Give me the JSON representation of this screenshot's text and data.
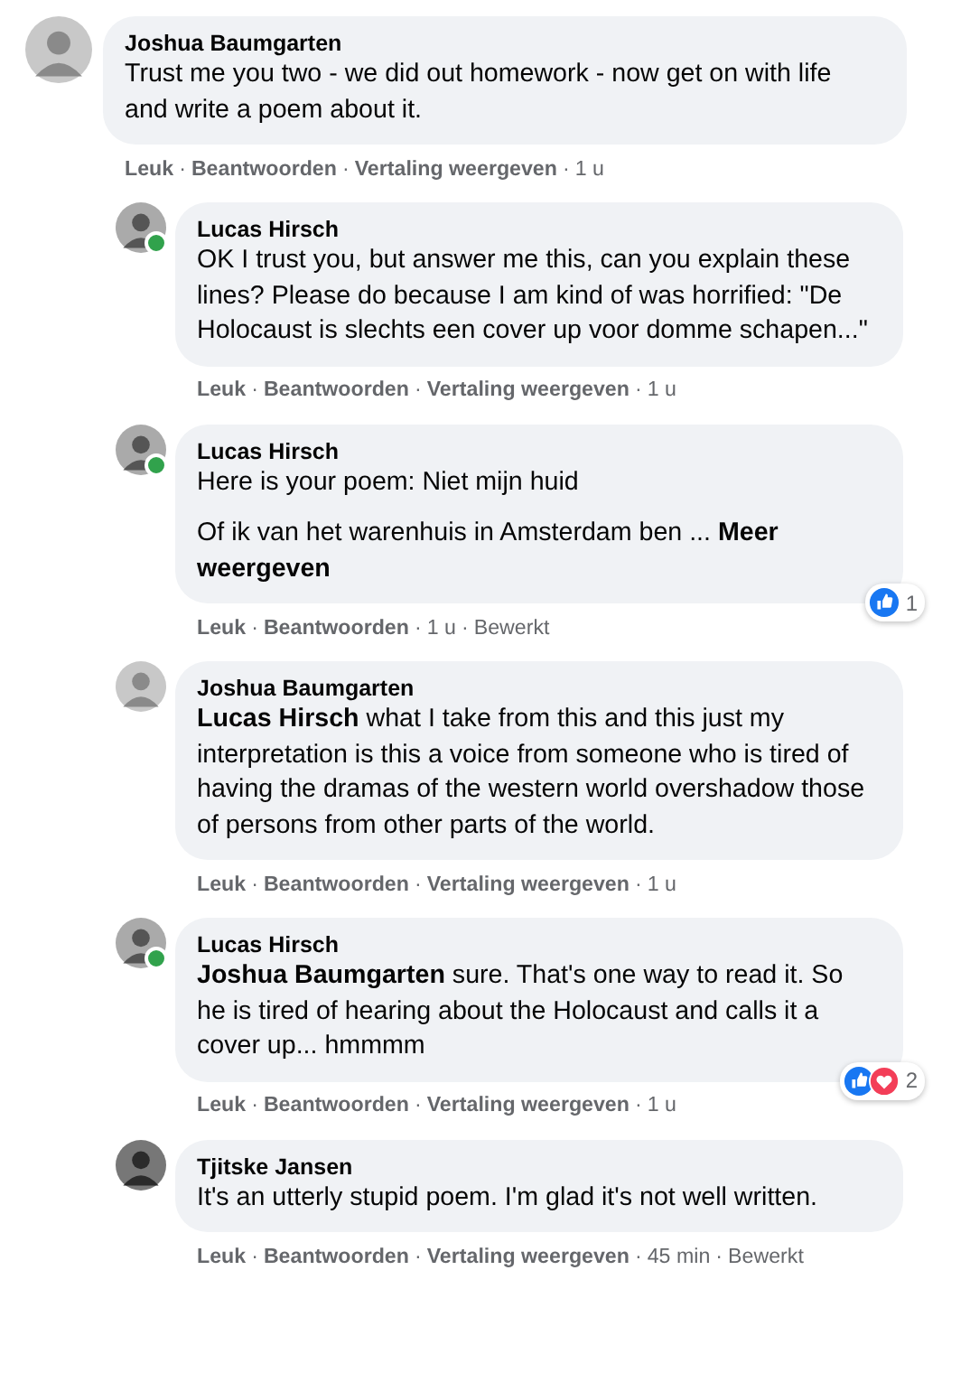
{
  "separator": "·",
  "comments": [
    {
      "kind": "comment",
      "author": "Joshua Baumgarten",
      "online": false,
      "paragraphs": [
        "Trust me you two - we did out homework - now get on with life and write a poem about it."
      ],
      "meta": [
        {
          "text": "Leuk",
          "kind": "action"
        },
        {
          "text": "Beantwoorden",
          "kind": "action"
        },
        {
          "text": "Vertaling weergeven",
          "kind": "action"
        },
        {
          "text": "1 u",
          "kind": "info"
        }
      ]
    },
    {
      "kind": "reply",
      "author": "Lucas Hirsch",
      "online": true,
      "paragraphs": [
        "OK I trust you, but answer me this, can you explain these lines? Please do because I am kind of was horrified: \"De Holocaust is slechts een cover up voor domme schapen...\""
      ],
      "meta": [
        {
          "text": "Leuk",
          "kind": "action"
        },
        {
          "text": "Beantwoorden",
          "kind": "action"
        },
        {
          "text": "Vertaling weergeven",
          "kind": "action"
        },
        {
          "text": "1 u",
          "kind": "info"
        }
      ]
    },
    {
      "kind": "reply",
      "author": "Lucas Hirsch",
      "online": true,
      "paragraphs": [
        "Here is your poem: Niet mijn huid",
        "Of ik van het warenhuis in Amsterdam ben ... **Meer weergeven**"
      ],
      "reactions": {
        "icons": [
          {
            "kind": "like"
          }
        ],
        "count": "1"
      },
      "meta": [
        {
          "text": "Leuk",
          "kind": "action"
        },
        {
          "text": "Beantwoorden",
          "kind": "action"
        },
        {
          "text": "1 u",
          "kind": "info"
        },
        {
          "text": "Bewerkt",
          "kind": "info"
        }
      ]
    },
    {
      "kind": "reply",
      "author": "Joshua Baumgarten",
      "online": false,
      "paragraphs": [
        "**Lucas Hirsch** what I take from this and this just my interpretation is this a voice from someone who is tired of having the dramas of the western world overshadow those of persons from other parts of the world."
      ],
      "meta": [
        {
          "text": "Leuk",
          "kind": "action"
        },
        {
          "text": "Beantwoorden",
          "kind": "action"
        },
        {
          "text": "Vertaling weergeven",
          "kind": "action"
        },
        {
          "text": "1 u",
          "kind": "info"
        }
      ]
    },
    {
      "kind": "reply",
      "author": "Lucas Hirsch",
      "online": true,
      "paragraphs": [
        "**Joshua Baumgarten** sure. That's one way to read it. So he is tired of hearing about the Holocaust and calls it a cover up... hmmmm"
      ],
      "reactions": {
        "icons": [
          {
            "kind": "like"
          },
          {
            "kind": "love"
          }
        ],
        "count": "2"
      },
      "meta": [
        {
          "text": "Leuk",
          "kind": "action"
        },
        {
          "text": "Beantwoorden",
          "kind": "action"
        },
        {
          "text": "Vertaling weergeven",
          "kind": "action"
        },
        {
          "text": "1 u",
          "kind": "info"
        }
      ]
    },
    {
      "kind": "reply",
      "author": "Tjitske Jansen",
      "online": false,
      "paragraphs": [
        "It's an utterly stupid poem. I'm glad it's not well written."
      ],
      "meta": [
        {
          "text": "Leuk",
          "kind": "action"
        },
        {
          "text": "Beantwoorden",
          "kind": "action"
        },
        {
          "text": "Vertaling weergeven",
          "kind": "action"
        },
        {
          "text": "45 min",
          "kind": "info"
        },
        {
          "text": "Bewerkt",
          "kind": "info"
        }
      ]
    }
  ]
}
